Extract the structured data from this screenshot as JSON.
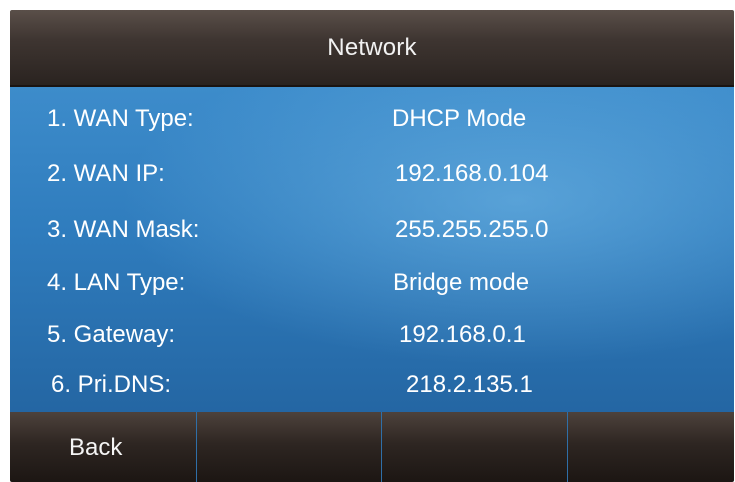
{
  "title": "Network",
  "rows": [
    {
      "label": "1. WAN Type:",
      "value": "DHCP Mode"
    },
    {
      "label": "2. WAN IP:",
      "value": "192.168.0.104"
    },
    {
      "label": "3. WAN Mask:",
      "value": "255.255.255.0"
    },
    {
      "label": "4. LAN Type:",
      "value": "Bridge mode"
    },
    {
      "label": "5. Gateway:",
      "value": "192.168.0.1"
    },
    {
      "label": "6. Pri.DNS:",
      "value": "218.2.135.1"
    }
  ],
  "softkeys": [
    {
      "label": "Back"
    },
    {
      "label": ""
    },
    {
      "label": ""
    },
    {
      "label": ""
    }
  ],
  "colors": {
    "title_bar": "#3e3531",
    "content_background": "#2f7cbd",
    "softkey_bar": "#2e2622",
    "text": "#ffffff"
  }
}
